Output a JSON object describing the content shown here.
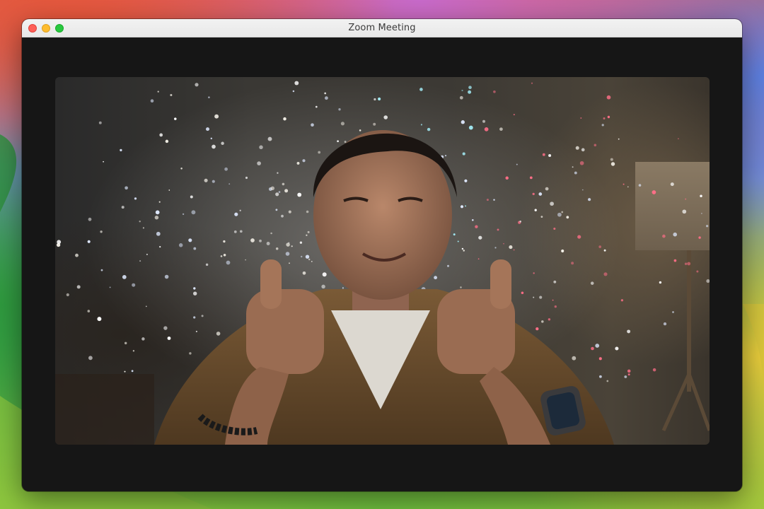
{
  "window": {
    "title": "Zoom Meeting"
  },
  "video": {
    "description_icon": "participant-video-with-fireworks-reaction",
    "reaction": "fireworks"
  },
  "colors": {
    "titlebar": "#ececec",
    "meeting_background": "#161616",
    "close": "#fe5f57",
    "minimize": "#febc2e",
    "zoom": "#28c840"
  }
}
